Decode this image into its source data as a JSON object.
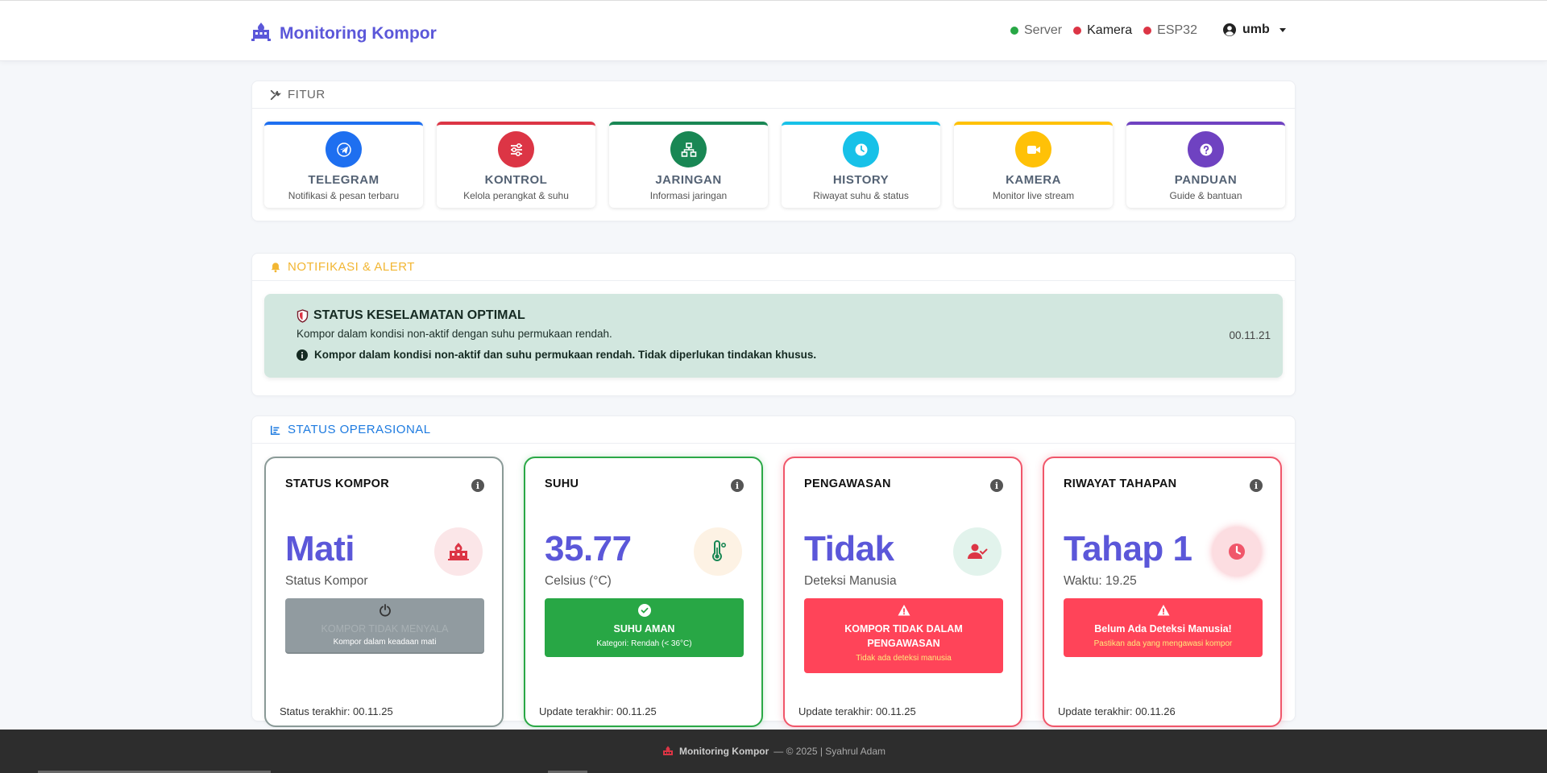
{
  "navbar": {
    "brand": "Monitoring Kompor",
    "status": [
      {
        "label": "Server",
        "color": "#28a745"
      },
      {
        "label": "Kamera",
        "color": "#dc3545"
      },
      {
        "label": "ESP32",
        "color": "#dc3545"
      }
    ],
    "user": "umb"
  },
  "fitur": {
    "heading": "FITUR",
    "items": [
      {
        "title": "TELEGRAM",
        "subtitle": "Notifikasi & pesan terbaru",
        "color": "#1e6ff0",
        "icon": "telegram-icon"
      },
      {
        "title": "KONTROL",
        "subtitle": "Kelola perangkat & suhu",
        "color": "#dc3545",
        "icon": "sliders-icon"
      },
      {
        "title": "JARINGAN",
        "subtitle": "Informasi jaringan",
        "color": "#198754",
        "icon": "network-icon"
      },
      {
        "title": "HISTORY",
        "subtitle": "Riwayat suhu & status",
        "color": "#17c1e8",
        "icon": "clock-icon"
      },
      {
        "title": "KAMERA",
        "subtitle": "Monitor live stream",
        "color": "#ffc107",
        "icon": "video-icon"
      },
      {
        "title": "PANDUAN",
        "subtitle": "Guide & bantuan",
        "color": "#6f42c1",
        "icon": "question-icon"
      }
    ]
  },
  "notifikasi": {
    "heading": "NOTIFIKASI & ALERT",
    "alert": {
      "title": "STATUS KESELAMATAN OPTIMAL",
      "message": "Kompor dalam kondisi non-aktif dengan suhu permukaan rendah.",
      "note": "Kompor dalam kondisi non-aktif dan suhu permukaan rendah. Tidak diperlukan tindakan khusus.",
      "time": "00.11.21"
    }
  },
  "status_operasional": {
    "heading": "STATUS OPERASIONAL",
    "cards": [
      {
        "title": "STATUS KOMPOR",
        "value": "Mati",
        "label": "Status Kompor",
        "box_main": "KOMPOR TIDAK MENYALA",
        "box_sub": "Kompor dalam keadaan mati",
        "footer": "Status terakhir: 00.11.25",
        "icon": "stove-icon"
      },
      {
        "title": "SUHU",
        "value": "35.77",
        "label": "Celsius (°C)",
        "box_main": "SUHU AMAN",
        "box_sub": "Kategori: Rendah (< 36°C)",
        "footer": "Update terakhir: 00.11.25",
        "icon": "thermometer-icon"
      },
      {
        "title": "PENGAWASAN",
        "value": "Tidak",
        "label": "Deteksi Manusia",
        "box_main": "KOMPOR TIDAK DALAM PENGAWASAN",
        "box_sub": "Tidak ada deteksi manusia",
        "footer": "Update terakhir: 00.11.25",
        "icon": "user-check-icon"
      },
      {
        "title": "RIWAYAT TAHAPAN",
        "value": "Tahap 1",
        "label": "Waktu: 19.25",
        "box_main": "Belum Ada Deteksi Manusia!",
        "box_sub": "Pastikan ada yang mengawasi kompor",
        "footer": "Update terakhir: 00.11.26",
        "icon": "clock-icon"
      }
    ]
  },
  "footer": {
    "brand": "Monitoring Kompor",
    "text": "— © 2025 | Syahrul Adam"
  }
}
